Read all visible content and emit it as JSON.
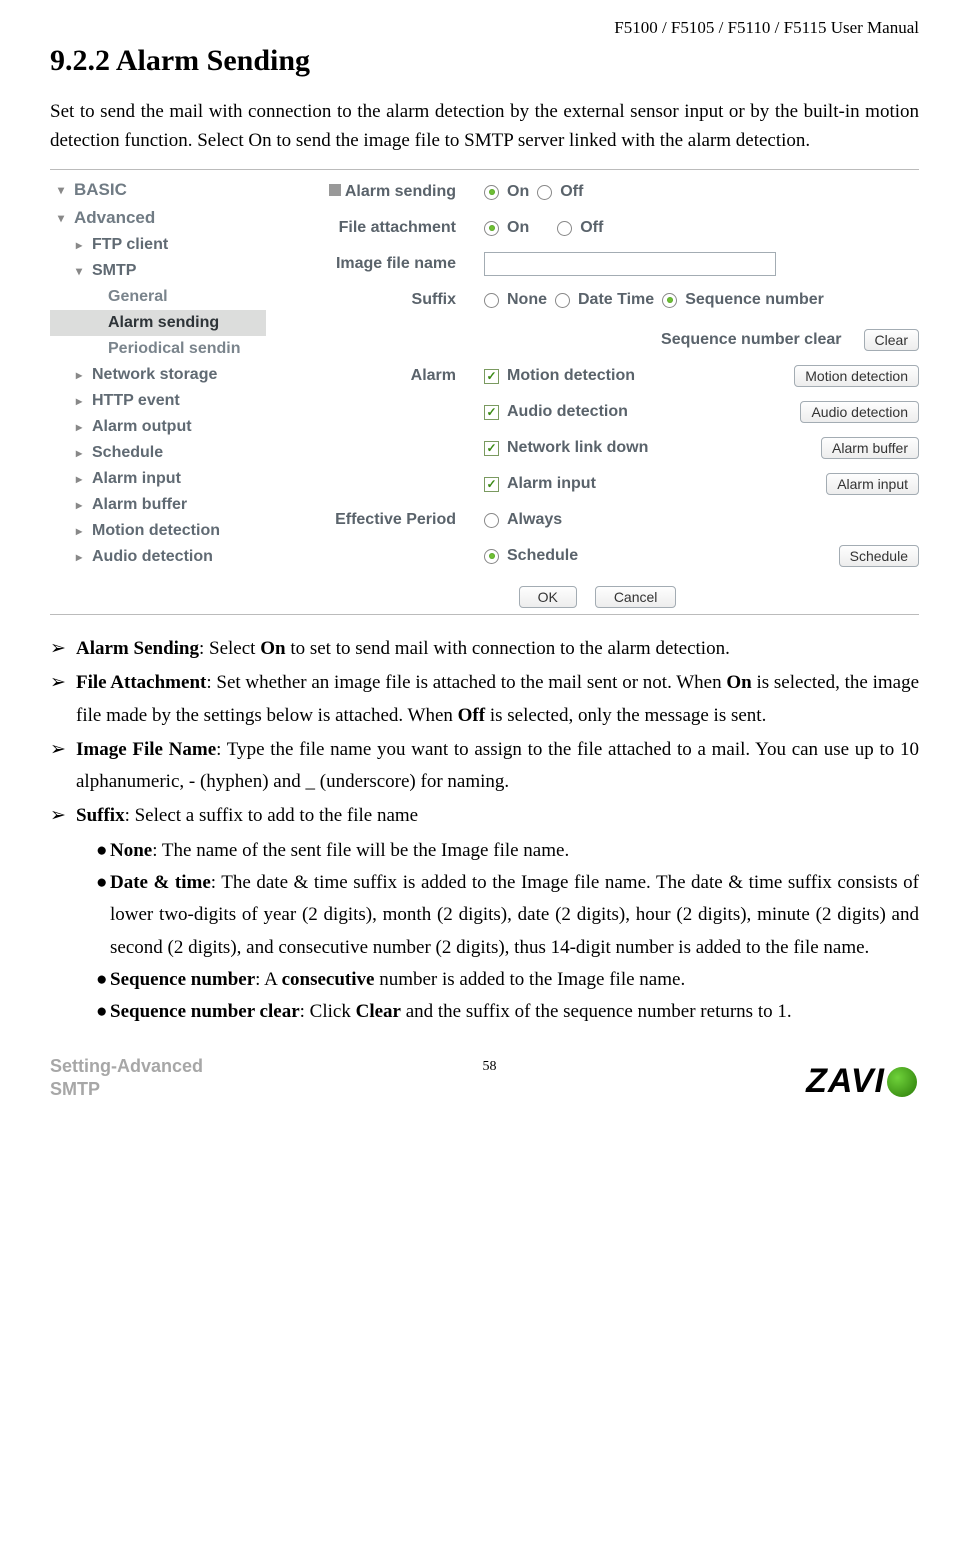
{
  "header": {
    "title": "F5100 / F5105 / F5110 / F5115 User Manual"
  },
  "section": {
    "number_title": "9.2.2 Alarm Sending",
    "intro": "Set to send the mail with connection to the alarm detection by the external sensor input or by the built-in motion detection function. Select On to send the image file to SMTP server linked with the alarm detection."
  },
  "ui": {
    "nav": {
      "basic": "BASIC",
      "advanced": "Advanced",
      "ftp": "FTP client",
      "smtp": "SMTP",
      "smtp_children": {
        "general": "General",
        "alarm_sending": "Alarm sending",
        "periodical": "Periodical sendin"
      },
      "network_storage": "Network storage",
      "http_event": "HTTP event",
      "alarm_output": "Alarm output",
      "schedule": "Schedule",
      "alarm_input": "Alarm input",
      "alarm_buffer": "Alarm buffer",
      "motion": "Motion detection",
      "audio": "Audio detection"
    },
    "rows": {
      "alarm_sending": {
        "label": "Alarm sending",
        "on": "On",
        "off": "Off"
      },
      "file_attachment": {
        "label": "File attachment",
        "on": "On",
        "off": "Off"
      },
      "image_file_name": {
        "label": "Image file name",
        "value": ""
      },
      "suffix": {
        "label": "Suffix",
        "none": "None",
        "datetime": "Date Time",
        "seq": "Sequence number"
      },
      "seq_clear": {
        "label": "Sequence number clear",
        "btn": "Clear"
      },
      "alarm": {
        "label": "Alarm",
        "motion": "Motion detection",
        "motion_btn": "Motion detection",
        "audio": "Audio detection",
        "audio_btn": "Audio detection",
        "network": "Network link down",
        "network_btn": "Alarm buffer",
        "input": "Alarm input",
        "input_btn": "Alarm input"
      },
      "effective": {
        "label": "Effective Period",
        "always": "Always",
        "schedule": "Schedule",
        "schedule_btn": "Schedule"
      },
      "ok": "OK",
      "cancel": "Cancel"
    }
  },
  "bullets": {
    "b1_strong": "Alarm Sending",
    "b1_rest": ": Select ",
    "b1_on": "On",
    "b1_rest2": " to set to send mail with connection to the alarm detection.",
    "b2_strong": "File Attachment",
    "b2_rest": ": Set whether an image file is attached to the mail sent or not. When ",
    "b2_on": "On",
    "b2_rest2": " is selected, the image file made by the settings below is attached. When ",
    "b2_off": "Off",
    "b2_rest3": " is selected, only the message is sent.",
    "b3_strong": "Image File Name",
    "b3_rest": ": Type the file name you want to assign to the file attached to a mail. You can use up to 10 alphanumeric, - (hyphen) and _ (underscore) for naming.",
    "b4_strong": "Suffix",
    "b4_rest": ": Select a suffix to add to the file name",
    "s1_strong": "None",
    "s1_rest": ": The name of the sent file will be the Image file name.",
    "s2_strong": "Date & time",
    "s2_rest": ": The date & time suffix is added to the Image file name. The date & time suffix consists of lower two-digits of year (2 digits), month (2 digits), date (2 digits), hour (2 digits), minute (2 digits) and second (2 digits), and consecutive number (2 digits), thus 14-digit number is added to the file name.",
    "s3_strong": "Sequence number",
    "s3_rest_a": ": A ",
    "s3_consec": "consecutive",
    "s3_rest_b": " number is added to the Image file name.",
    "s4_strong": "Sequence number clear",
    "s4_rest_a": ": Click ",
    "s4_clear": "Clear",
    "s4_rest_b": " and the suffix of the sequence number returns to 1."
  },
  "footer": {
    "setting": "Setting-Advanced",
    "smtp": "SMTP",
    "page": "58",
    "logo_text_a": "ZAVI",
    "logo_text_b": ""
  }
}
